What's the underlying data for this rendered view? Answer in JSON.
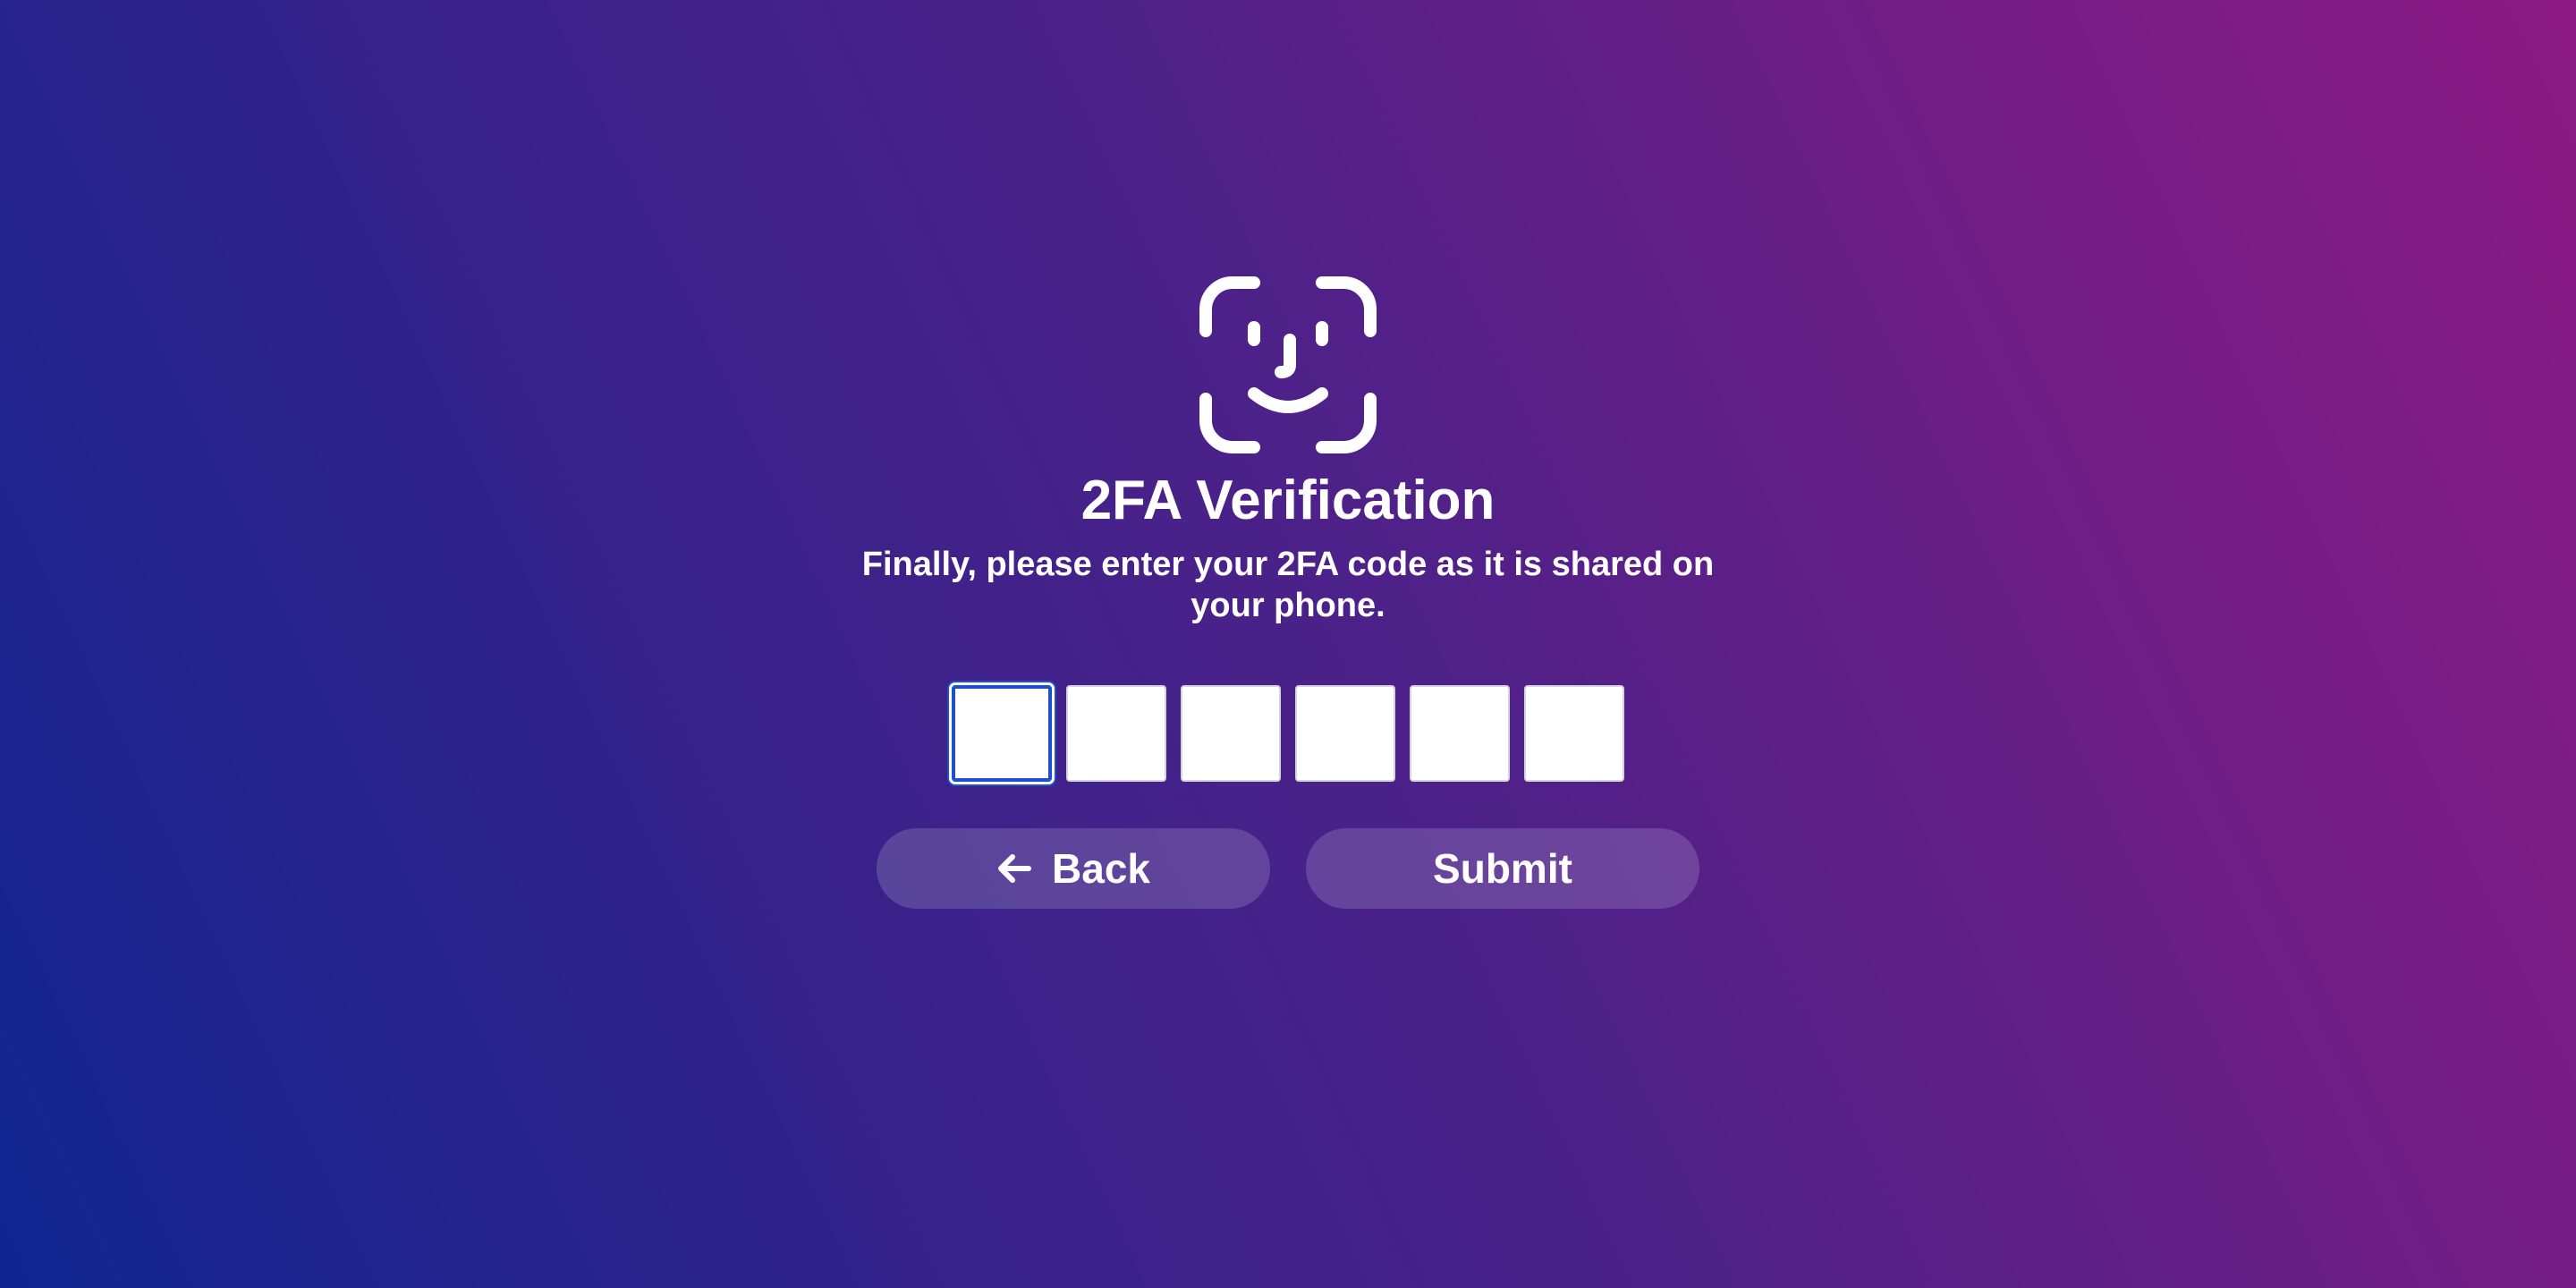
{
  "header": {
    "icon": "face-id-icon",
    "title": "2FA Verification",
    "subtitle": "Finally, please enter your 2FA code as it is shared on your phone."
  },
  "code_input": {
    "length": 6,
    "values": [
      "",
      "",
      "",
      "",
      "",
      ""
    ],
    "active_index": 0
  },
  "actions": {
    "back_label": "Back",
    "back_icon": "arrow-left-icon",
    "submit_label": "Submit"
  },
  "colors": {
    "background_start": "#102592",
    "background_end": "#8c1a84",
    "focus_border": "#1e4fd0",
    "button_fill": "rgba(255,255,255,0.16)"
  }
}
